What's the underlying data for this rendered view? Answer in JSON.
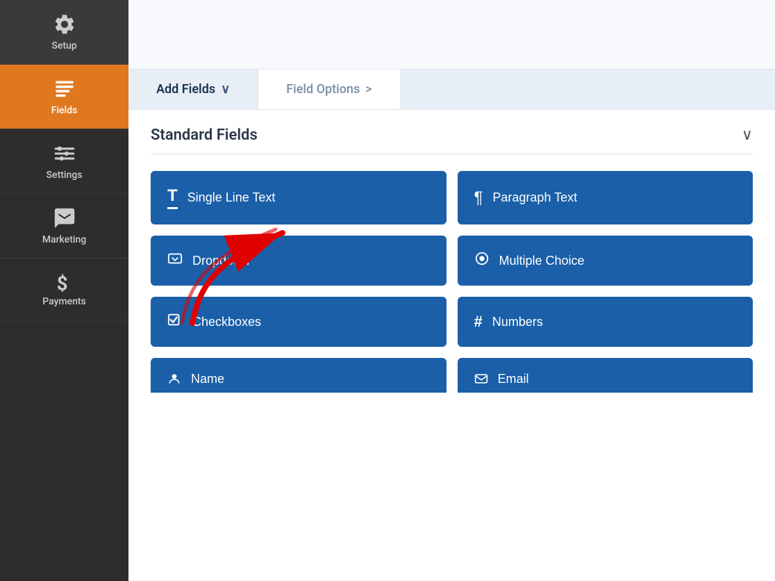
{
  "sidebar": {
    "items": [
      {
        "id": "setup",
        "label": "Setup",
        "icon": "⚙",
        "active": false
      },
      {
        "id": "fields",
        "label": "Fields",
        "icon": "▤",
        "active": true
      },
      {
        "id": "settings",
        "label": "Settings",
        "icon": "⊟",
        "active": false
      },
      {
        "id": "marketing",
        "label": "Marketing",
        "icon": "📢",
        "active": false
      },
      {
        "id": "payments",
        "label": "Payments",
        "icon": "$",
        "active": false
      }
    ]
  },
  "tabs": [
    {
      "id": "add-fields",
      "label": "Add Fields",
      "active": true,
      "chevron": "∨"
    },
    {
      "id": "field-options",
      "label": "Field Options",
      "active": false,
      "chevron": ">"
    }
  ],
  "section": {
    "title": "Standard Fields",
    "chevron": "∨"
  },
  "fields": [
    {
      "id": "single-line-text",
      "icon": "T̲",
      "label": "Single Line Text"
    },
    {
      "id": "paragraph-text",
      "icon": "¶",
      "label": "Paragraph Text"
    },
    {
      "id": "dropdown",
      "icon": "☑",
      "label": "Dropdown"
    },
    {
      "id": "multiple-choice",
      "icon": "⊙",
      "label": "Multiple Choice"
    },
    {
      "id": "checkboxes",
      "icon": "☑",
      "label": "Checkboxes"
    },
    {
      "id": "numbers",
      "icon": "#",
      "label": "Numbers"
    }
  ],
  "partial_fields": [
    {
      "id": "name",
      "label": "Name"
    },
    {
      "id": "email",
      "label": "Email"
    }
  ],
  "colors": {
    "sidebar_bg": "#2d2d2d",
    "active_nav": "#e07820",
    "field_btn": "#1a5fa8",
    "section_bg": "#e8eef6"
  }
}
